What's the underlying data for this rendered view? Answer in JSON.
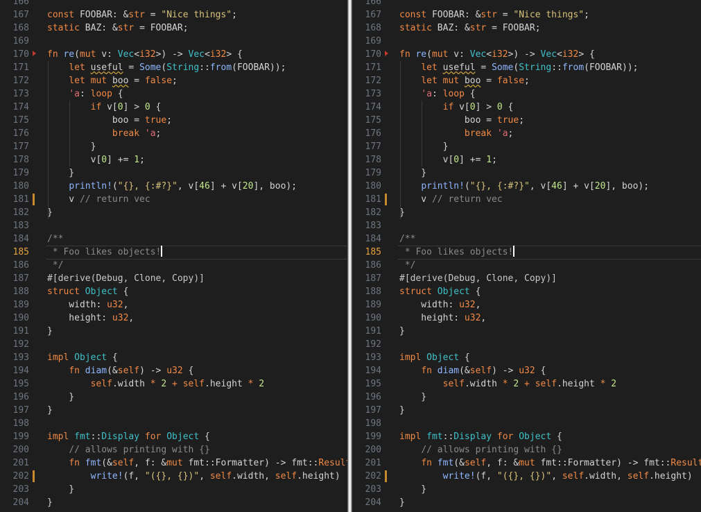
{
  "panes": [
    {
      "id": "left",
      "name": "left-editor-pane"
    },
    {
      "id": "right",
      "name": "right-editor-pane"
    }
  ],
  "editor": {
    "first_line_number": 166,
    "active_line": 185,
    "modified_lines": [
      181,
      202
    ],
    "fold_lines": [
      170
    ],
    "colors": {
      "background": "#1e1e1e",
      "keyword": "#f28a45",
      "type": "#3fc1c9",
      "function": "#8fb6ff",
      "string": "#d7c27a",
      "number": "#c3e88d",
      "comment": "#8a8a8a",
      "active_line_number": "#e6a23c",
      "modified_marker": "#c78a2e"
    },
    "lines": [
      [
        [
          "pl",
          ""
        ]
      ],
      [
        [
          "kw",
          "const"
        ],
        [
          "pl",
          " FOOBAR: "
        ],
        [
          "pl",
          "&"
        ],
        [
          "kw",
          "str"
        ],
        [
          "pl",
          " = "
        ],
        [
          "str",
          "\"Nice things\""
        ],
        [
          "pl",
          ";"
        ]
      ],
      [
        [
          "kw",
          "static"
        ],
        [
          "pl",
          " BAZ: "
        ],
        [
          "pl",
          "&"
        ],
        [
          "kw",
          "str"
        ],
        [
          "pl",
          " = FOOBAR;"
        ]
      ],
      [
        [
          "pl",
          ""
        ]
      ],
      [
        [
          "kw",
          "fn"
        ],
        [
          "pl",
          " "
        ],
        [
          "fn",
          "re"
        ],
        [
          "pl",
          "("
        ],
        [
          "kw",
          "mut"
        ],
        [
          "pl",
          " v: "
        ],
        [
          "ty",
          "Vec"
        ],
        [
          "pl",
          "<"
        ],
        [
          "kw",
          "i32"
        ],
        [
          "pl",
          ">) -> "
        ],
        [
          "ty",
          "Vec"
        ],
        [
          "pl",
          "<"
        ],
        [
          "kw",
          "i32"
        ],
        [
          "pl",
          "> {"
        ]
      ],
      [
        [
          "pl",
          "    "
        ],
        [
          "kw",
          "let"
        ],
        [
          "pl",
          " "
        ],
        [
          "sq",
          "useful"
        ],
        [
          "pl",
          " = "
        ],
        [
          "fn",
          "Some"
        ],
        [
          "pl",
          "("
        ],
        [
          "ty",
          "String"
        ],
        [
          "pl",
          "::"
        ],
        [
          "fn",
          "from"
        ],
        [
          "pl",
          "(FOOBAR));"
        ]
      ],
      [
        [
          "pl",
          "    "
        ],
        [
          "kw",
          "let mut"
        ],
        [
          "pl",
          " "
        ],
        [
          "sq",
          "boo"
        ],
        [
          "pl",
          " = "
        ],
        [
          "kw",
          "false"
        ],
        [
          "pl",
          ";"
        ]
      ],
      [
        [
          "pl",
          "    "
        ],
        [
          "lt",
          "'a"
        ],
        [
          "pl",
          ": "
        ],
        [
          "kw",
          "loop"
        ],
        [
          "pl",
          " {"
        ]
      ],
      [
        [
          "pl",
          "        "
        ],
        [
          "kw",
          "if"
        ],
        [
          "pl",
          " v["
        ],
        [
          "num",
          "0"
        ],
        [
          "pl",
          "] > "
        ],
        [
          "num",
          "0"
        ],
        [
          "pl",
          " {"
        ]
      ],
      [
        [
          "pl",
          "            boo = "
        ],
        [
          "kw",
          "true"
        ],
        [
          "pl",
          ";"
        ]
      ],
      [
        [
          "pl",
          "            "
        ],
        [
          "kw",
          "break"
        ],
        [
          "pl",
          " "
        ],
        [
          "lt",
          "'a"
        ],
        [
          "pl",
          ";"
        ]
      ],
      [
        [
          "pl",
          "        }"
        ]
      ],
      [
        [
          "pl",
          "        v["
        ],
        [
          "num",
          "0"
        ],
        [
          "pl",
          "] += "
        ],
        [
          "num",
          "1"
        ],
        [
          "pl",
          ";"
        ]
      ],
      [
        [
          "pl",
          "    }"
        ]
      ],
      [
        [
          "pl",
          "    "
        ],
        [
          "mac",
          "println!"
        ],
        [
          "pl",
          "("
        ],
        [
          "str",
          "\"{}, {:#?}\""
        ],
        [
          "pl",
          ", v["
        ],
        [
          "num",
          "46"
        ],
        [
          "pl",
          "] + v["
        ],
        [
          "num",
          "20"
        ],
        [
          "pl",
          "], boo);"
        ]
      ],
      [
        [
          "pl",
          "    v "
        ],
        [
          "cm",
          "// return vec"
        ]
      ],
      [
        [
          "pl",
          "}"
        ]
      ],
      [
        [
          "pl",
          ""
        ]
      ],
      [
        [
          "cm",
          "/**"
        ]
      ],
      [
        [
          "cm",
          " * Foo likes objects!"
        ]
      ],
      [
        [
          "cm",
          " */"
        ]
      ],
      [
        [
          "attr",
          "#[derive(Debug, Clone, Copy)]"
        ]
      ],
      [
        [
          "kw",
          "struct"
        ],
        [
          "pl",
          " "
        ],
        [
          "ty",
          "Object"
        ],
        [
          "pl",
          " {"
        ]
      ],
      [
        [
          "pl",
          "    width: "
        ],
        [
          "kw",
          "u32"
        ],
        [
          "pl",
          ","
        ]
      ],
      [
        [
          "pl",
          "    height: "
        ],
        [
          "kw",
          "u32"
        ],
        [
          "pl",
          ","
        ]
      ],
      [
        [
          "pl",
          "}"
        ]
      ],
      [
        [
          "pl",
          ""
        ]
      ],
      [
        [
          "kw",
          "impl"
        ],
        [
          "pl",
          " "
        ],
        [
          "ty",
          "Object"
        ],
        [
          "pl",
          " {"
        ]
      ],
      [
        [
          "pl",
          "    "
        ],
        [
          "kw",
          "fn"
        ],
        [
          "pl",
          " "
        ],
        [
          "fn",
          "diam"
        ],
        [
          "pl",
          "(&"
        ],
        [
          "kw",
          "self"
        ],
        [
          "pl",
          ") -> "
        ],
        [
          "kw",
          "u32"
        ],
        [
          "pl",
          " {"
        ]
      ],
      [
        [
          "pl",
          "        "
        ],
        [
          "kw",
          "self"
        ],
        [
          "pl",
          ".width "
        ],
        [
          "kw",
          "*"
        ],
        [
          "pl",
          " "
        ],
        [
          "num",
          "2"
        ],
        [
          "pl",
          " "
        ],
        [
          "kw",
          "+"
        ],
        [
          "pl",
          " "
        ],
        [
          "kw",
          "self"
        ],
        [
          "pl",
          ".height "
        ],
        [
          "kw",
          "*"
        ],
        [
          "pl",
          " "
        ],
        [
          "num",
          "2"
        ]
      ],
      [
        [
          "pl",
          "    }"
        ]
      ],
      [
        [
          "pl",
          "}"
        ]
      ],
      [
        [
          "pl",
          ""
        ]
      ],
      [
        [
          "kw",
          "impl"
        ],
        [
          "pl",
          " "
        ],
        [
          "ty",
          "fmt"
        ],
        [
          "pl",
          "::"
        ],
        [
          "ty",
          "Display"
        ],
        [
          "pl",
          " "
        ],
        [
          "kw",
          "for"
        ],
        [
          "pl",
          " "
        ],
        [
          "ty",
          "Object"
        ],
        [
          "pl",
          " {"
        ]
      ],
      [
        [
          "pl",
          "    "
        ],
        [
          "cm",
          "// allows printing with {}"
        ]
      ],
      [
        [
          "pl",
          "    "
        ],
        [
          "kw",
          "fn"
        ],
        [
          "pl",
          " "
        ],
        [
          "fn",
          "fmt"
        ],
        [
          "pl",
          "(&"
        ],
        [
          "kw",
          "self"
        ],
        [
          "pl",
          ", f: &"
        ],
        [
          "kw",
          "mut"
        ],
        [
          "pl",
          " fmt::Formatter) -> fmt::"
        ],
        [
          "kw",
          "Result"
        ]
      ],
      [
        [
          "pl",
          "        "
        ],
        [
          "mac",
          "write!"
        ],
        [
          "pl",
          "(f, "
        ],
        [
          "str",
          "\"({}, {})\""
        ],
        [
          "pl",
          ", "
        ],
        [
          "kw",
          "self"
        ],
        [
          "pl",
          ".width, "
        ],
        [
          "kw",
          "self"
        ],
        [
          "pl",
          ".height)"
        ]
      ],
      [
        [
          "pl",
          "    }"
        ]
      ],
      [
        [
          "pl",
          "}"
        ]
      ]
    ]
  }
}
